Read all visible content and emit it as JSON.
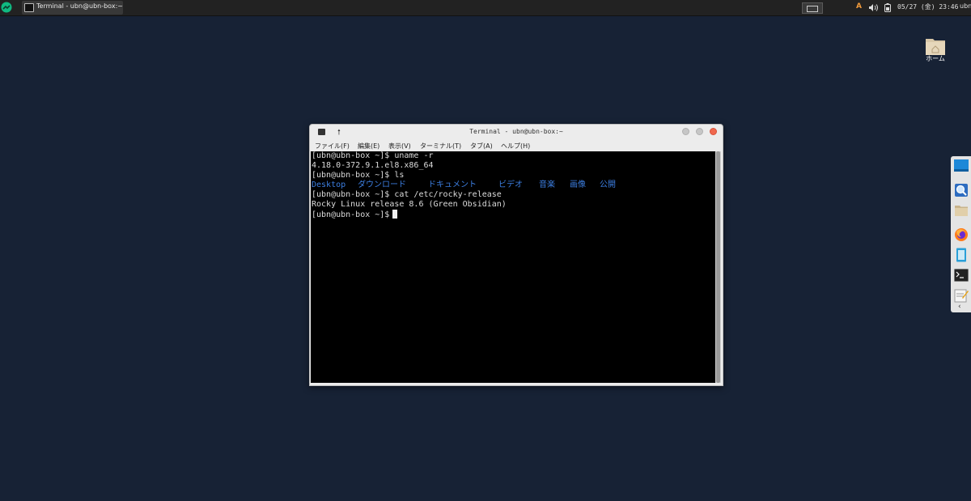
{
  "top_panel": {
    "task_label": "Terminal - ubn@ubn-box:~",
    "input_method": "A",
    "clock": "05/27 (金) 23:46",
    "user": "ubn"
  },
  "desktop": {
    "home_label": "ホーム"
  },
  "dock": {
    "items": [
      "desktop-icon",
      "search-icon",
      "files-icon",
      "firefox-icon",
      "mousepad-icon",
      "terminal-icon",
      "notes-icon"
    ],
    "collapse": "‹"
  },
  "terminal": {
    "title": "Terminal - ubn@ubn-box:~",
    "menu": [
      "ファイル(F)",
      "編集(E)",
      "表示(V)",
      "ターミナル(T)",
      "タブ(A)",
      "ヘルプ(H)"
    ],
    "lines": {
      "l1": "[ubn@ubn-box ~]$ uname -r",
      "l2": "4.18.0-372.9.1.el8.x86_64",
      "l3": "[ubn@ubn-box ~]$ ls",
      "l5": "[ubn@ubn-box ~]$ cat /etc/rocky-release",
      "l6": "Rocky Linux release 8.6 (Green Obsidian)",
      "l7": "[ubn@ubn-box ~]$"
    },
    "ls_output": [
      "Desktop",
      "ダウンロード",
      "ドキュメント",
      "ビデオ",
      "音楽",
      "画像",
      "公開"
    ]
  },
  "colors": {
    "desktop_bg": "#172235",
    "ls_dir": "#3c7ee0",
    "close_button": "#f0684e"
  }
}
